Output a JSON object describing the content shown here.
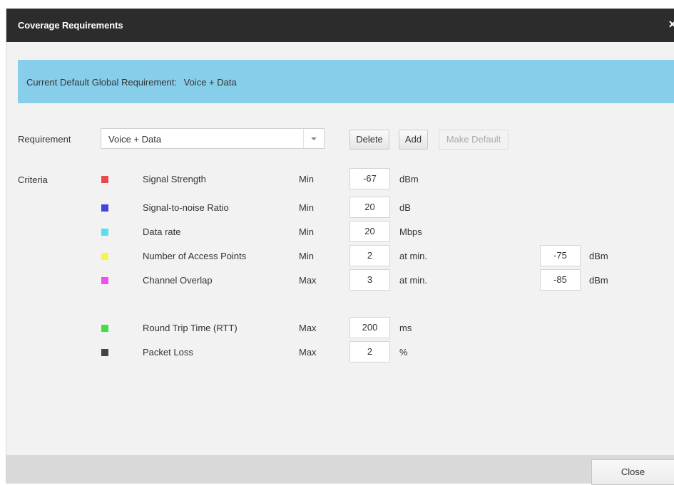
{
  "dialog": {
    "title": "Coverage Requirements",
    "close_glyph": "×"
  },
  "banner": {
    "label": "Current Default Global Requirement:",
    "value": "Voice + Data",
    "color": "#87ceea"
  },
  "requirement": {
    "label": "Requirement",
    "selected": "Voice + Data"
  },
  "buttons": {
    "delete": "Delete",
    "add": "Add",
    "make_default": "Make Default",
    "close": "Close"
  },
  "criteria": {
    "label": "Criteria",
    "rows": [
      {
        "name": "Signal Strength",
        "op": "Min",
        "value": "-67",
        "unit": "dBm",
        "color": "#e84a4a"
      },
      {
        "name": "Signal-to-noise Ratio",
        "op": "Min",
        "value": "20",
        "unit": "dB",
        "color": "#4444dd"
      },
      {
        "name": "Data rate",
        "op": "Min",
        "value": "20",
        "unit": "Mbps",
        "color": "#55e0f0"
      },
      {
        "name": "Number of Access Points",
        "op": "Min",
        "value": "2",
        "unit": "at min.",
        "value2": "-75",
        "unit2": "dBm",
        "color": "#f5f54a"
      },
      {
        "name": "Channel Overlap",
        "op": "Max",
        "value": "3",
        "unit": "at min.",
        "value2": "-85",
        "unit2": "dBm",
        "color": "#f04ef0"
      },
      {
        "name": "Round Trip Time (RTT)",
        "op": "Max",
        "value": "200",
        "unit": "ms",
        "color": "#44dd44"
      },
      {
        "name": "Packet Loss",
        "op": "Max",
        "value": "2",
        "unit": "%",
        "color": "#444444"
      }
    ]
  }
}
